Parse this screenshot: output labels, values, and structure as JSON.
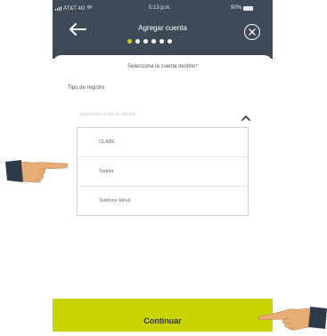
{
  "status_bar": {
    "carrier": "AT&T 4G",
    "time": "5:13 p.m.",
    "battery": "90%"
  },
  "header": {
    "title": "Agregar cuenta",
    "steps_total": 6,
    "step_current": 1
  },
  "subtitle": "Selecciona la cuenta destino*",
  "form": {
    "field_label": "Tipo de registro",
    "select_placeholder": "Selecciona el tipo de destino"
  },
  "dropdown": {
    "options": [
      "CLABE",
      "Tarjeta",
      "Teléfono Móvil"
    ]
  },
  "cta": {
    "label": "Continuar"
  },
  "colors": {
    "header": "#3e4a57",
    "accent": "#c8d400",
    "sleeve": "#2d3a4a"
  }
}
